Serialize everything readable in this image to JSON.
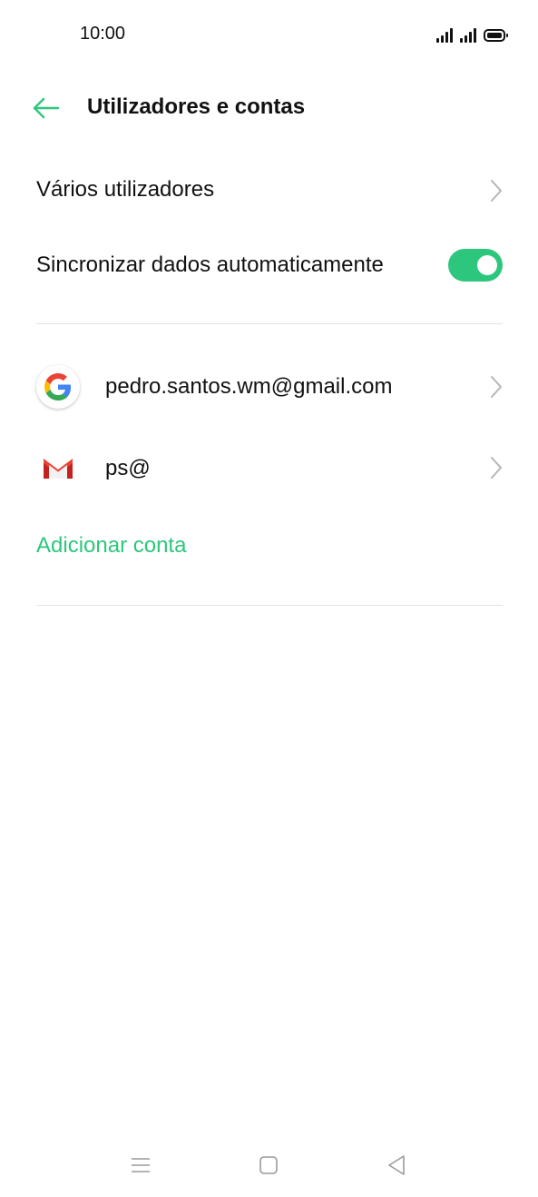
{
  "status_bar": {
    "time": "10:00"
  },
  "header": {
    "title": "Utilizadores e contas",
    "back_icon": "arrow-left-icon"
  },
  "settings": {
    "multiple_users_label": "Vários utilizadores",
    "auto_sync_label": "Sincronizar dados automaticamente",
    "auto_sync_enabled": true
  },
  "accounts": [
    {
      "label": "pedro.santos.wm@gmail.com",
      "icon": "google-icon"
    },
    {
      "label": "ps@",
      "icon": "gmail-icon"
    }
  ],
  "add_account_label": "Adicionar conta",
  "colors": {
    "accent": "#2cc77c",
    "text": "#111111",
    "divider": "#e3e3e3",
    "chevron": "#b5b5b5"
  },
  "nav": {
    "menu_icon": "menu-icon",
    "home_icon": "home-icon",
    "back_icon": "back-triangle-icon"
  }
}
